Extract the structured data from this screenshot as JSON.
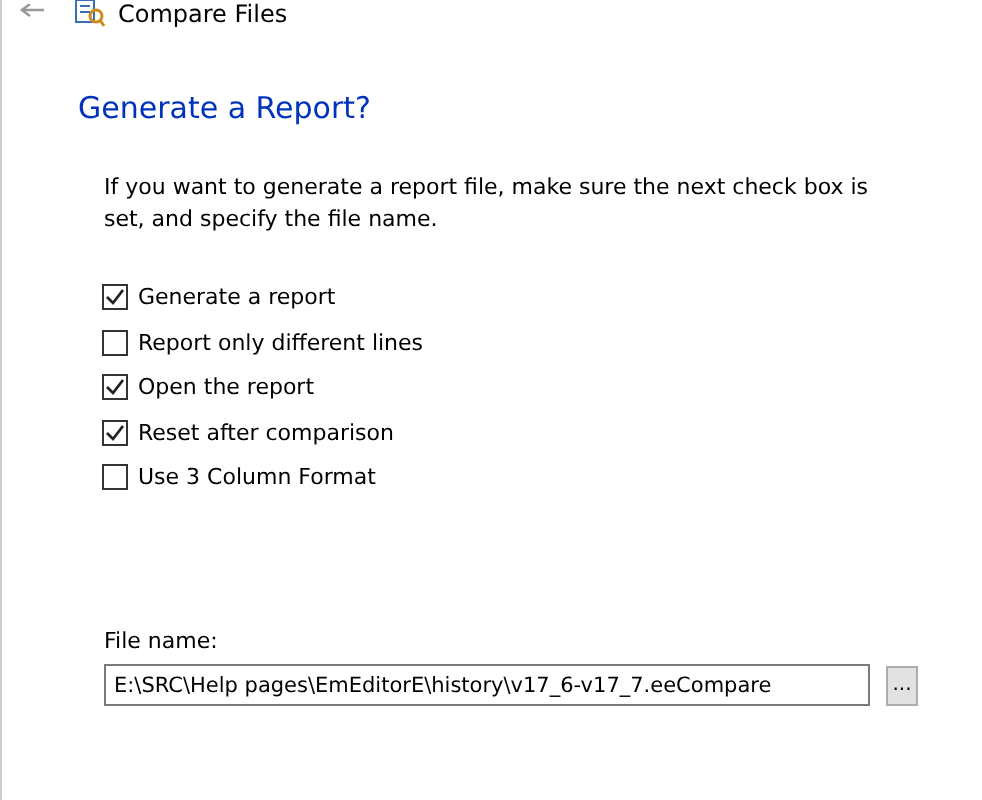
{
  "window": {
    "title": "Compare Files"
  },
  "heading": "Generate a Report?",
  "description": "If you want to generate a report file, make sure the next check box is set, and specify the file name.",
  "options": [
    {
      "label": "Generate a report",
      "checked": true
    },
    {
      "label": "Report only different lines",
      "checked": false
    },
    {
      "label": "Open the report",
      "checked": true
    },
    {
      "label": "Reset after comparison",
      "checked": true
    },
    {
      "label": "Use 3 Column Format",
      "checked": false
    }
  ],
  "file_name": {
    "label": "File name:",
    "value": "E:\\SRC\\Help pages\\EmEditorE\\history\\v17_6-v17_7.eeCompare",
    "browse": "..."
  }
}
